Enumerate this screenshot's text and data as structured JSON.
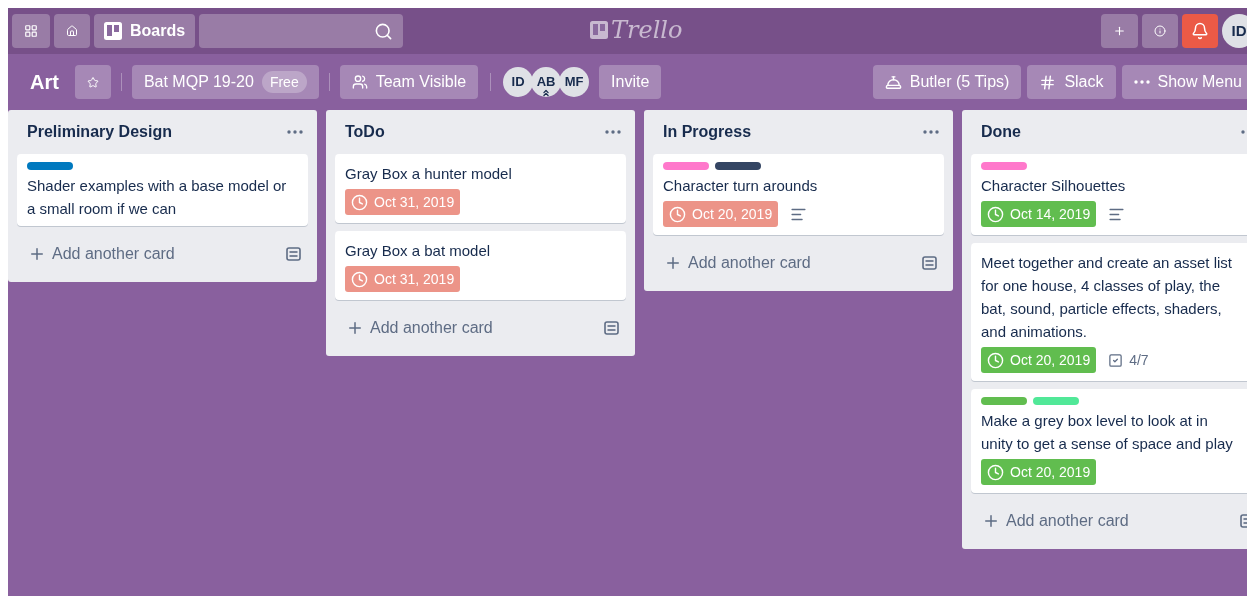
{
  "header": {
    "boards_label": "Boards",
    "logo": "Trello",
    "avatar": "ID"
  },
  "board": {
    "title": "Art",
    "starred": false,
    "team": "Bat MQP 19-20",
    "plan": "Free",
    "visibility": "Team Visible",
    "invite": "Invite",
    "butler": "Butler (5 Tips)",
    "slack": "Slack",
    "menu": "Show Menu",
    "members": [
      {
        "initials": "ID",
        "admin": false
      },
      {
        "initials": "AB",
        "admin": true
      },
      {
        "initials": "MF",
        "admin": false
      }
    ]
  },
  "lists": [
    {
      "title": "Preliminary Design",
      "add_label": "Add another card",
      "cards": [
        {
          "labels": [
            {
              "color": "#0079bf"
            }
          ],
          "lines": [
            "Shader examples with a base model or",
            "a small room if we can"
          ],
          "description": false
        }
      ]
    },
    {
      "title": "ToDo",
      "add_label": "Add another card",
      "cards": [
        {
          "lines": [
            "Gray Box a hunter model"
          ],
          "due": {
            "text": "Oct 31, 2019",
            "complete": false
          },
          "description": false
        },
        {
          "lines": [
            "Gray Box a bat model"
          ],
          "due": {
            "text": "Oct 31, 2019",
            "complete": false
          },
          "description": false
        }
      ]
    },
    {
      "title": "In Progress",
      "add_label": "Add another card",
      "cards": [
        {
          "labels": [
            {
              "color": "#ff78cb"
            },
            {
              "color": "#344563"
            }
          ],
          "lines": [
            "Character turn arounds"
          ],
          "due": {
            "text": "Oct 20, 2019",
            "complete": false
          },
          "description": true
        }
      ]
    },
    {
      "title": "Done",
      "add_label": "Add another card",
      "cards": [
        {
          "labels": [
            {
              "color": "#ff78cb"
            }
          ],
          "lines": [
            "Character Silhouettes"
          ],
          "due": {
            "text": "Oct 14, 2019",
            "complete": true
          },
          "description": true
        },
        {
          "lines": [
            "Meet together and create an asset list",
            "for one house, 4 classes of play, the",
            "bat, sound, particle effects, shaders,",
            "and animations."
          ],
          "due": {
            "text": "Oct 20, 2019",
            "complete": true
          },
          "description": false,
          "checklist": "4/7"
        },
        {
          "labels": [
            {
              "color": "#61bd4f"
            },
            {
              "color": "#51e898"
            }
          ],
          "lines": [
            "Make a grey box level to look at in",
            "unity to get a sense of space and play"
          ],
          "due": {
            "text": "Oct 20, 2019",
            "complete": true
          },
          "description": false
        }
      ]
    }
  ]
}
